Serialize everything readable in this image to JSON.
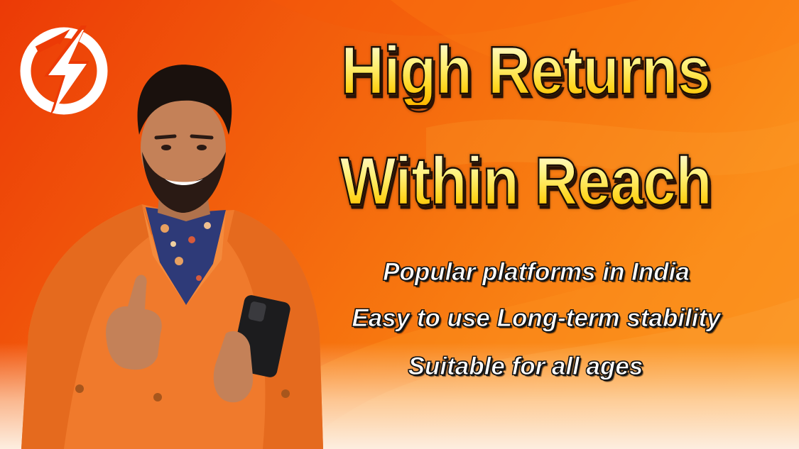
{
  "banner": {
    "logo_icon": "lightning-bolt-circle-icon",
    "headline_line1": "High Returns",
    "headline_line2": "Within Reach",
    "taglines": [
      "Popular platforms in India",
      "Easy to use Long-term stability",
      "Suitable for all ages"
    ],
    "image": "man-in-orange-suit-thumbs-up-holding-phone"
  },
  "colors": {
    "background_start": "#ec3a06",
    "background_end": "#fc9a24",
    "headline_fill": "#ffd21a",
    "headline_outline": "#1a0c03",
    "tagline_fill": "#ffffff",
    "tagline_outline": "#141414",
    "suit": "#f07a2c"
  }
}
